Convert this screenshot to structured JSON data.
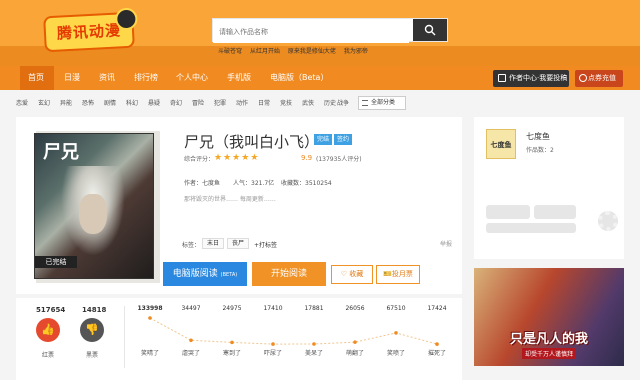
{
  "header": {
    "logo_text": "腾讯动漫",
    "search_placeholder": "请输入作品名称",
    "hot": [
      "斗破苍穹",
      "从红月开始",
      "原来我是修仙大佬",
      "我为邪帝"
    ]
  },
  "nav": {
    "items": [
      "首页",
      "日漫",
      "资讯",
      "排行榜",
      "个人中心",
      "手机版",
      "电脑版（Beta）"
    ],
    "author_center": "作者中心·我要投稿",
    "charge": "点券充值"
  },
  "categories": [
    "恋爱",
    "玄幻",
    "异能",
    "恐怖",
    "剧情",
    "科幻",
    "悬疑",
    "奇幻",
    "冒险",
    "犯罪",
    "动作",
    "日常",
    "竞技",
    "武侠",
    "历史",
    "战争"
  ],
  "all_categories_label": "全部分类",
  "book": {
    "title": "尸兄（我叫白小飞）",
    "badges": [
      "完结",
      "签约"
    ],
    "score_label": "综合评分：",
    "score": "9.9",
    "score_count": "(137935人评分)",
    "stars_filled": 5,
    "author": "作者：七度鱼",
    "popularity": "人气：321.7亿",
    "favorites": "收藏数：3510254",
    "description": "那将毁灭的世界……  每周更新……",
    "labels_prefix": "标签：",
    "labels": [
      "末日",
      "丧尸"
    ],
    "add_tag": "+打标签",
    "report": "举报",
    "btn_pc_read": "电脑版阅读",
    "btn_pc_read_sub": "(BETA)",
    "btn_start_read": "开始阅读",
    "btn_collect": "收藏",
    "btn_monthly": "投月票",
    "cover_title": "尸兄",
    "cover_status": "已完结"
  },
  "author_card": {
    "avatar_text": "七度鱼",
    "name": "七度鱼",
    "works": "作品数：2"
  },
  "ad": {
    "line1": "只是凡人的我",
    "line2": "却受千万人谨慎拜"
  },
  "votes": {
    "red": {
      "count": "517654",
      "label": "红票"
    },
    "black": {
      "count": "14818",
      "label": "黑票"
    }
  },
  "chart_data": {
    "type": "line",
    "categories": [
      "笑晴了",
      "虐哭了",
      "寒到了",
      "吓尿了",
      "美呆了",
      "萌翻了",
      "笑喷了",
      "摧死了"
    ],
    "values": [
      133998,
      34497,
      24975,
      17410,
      17881,
      26056,
      67510,
      17424
    ]
  }
}
